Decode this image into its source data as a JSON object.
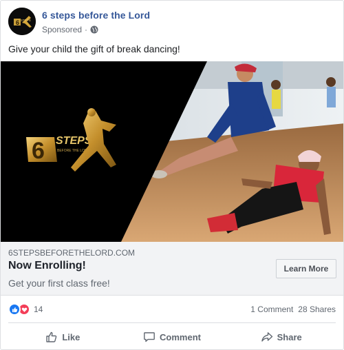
{
  "post": {
    "page_name": "6 steps before the Lord",
    "sponsored_label": "Sponsored",
    "separator": "·",
    "text": "Give your child the gift of break dancing!"
  },
  "media": {
    "logo_word": "STEPS",
    "logo_number": "6",
    "logo_sub": "BEFORE THE LORD"
  },
  "link_preview": {
    "domain": "6STEPSBEFORETHELORD.COM",
    "headline": "Now Enrolling!",
    "description": "Get your first class free!",
    "cta_label": "Learn More"
  },
  "reactions": {
    "count": "14",
    "comments": "1 Comment",
    "shares": "28 Shares",
    "icons": [
      "like-icon",
      "love-icon"
    ]
  },
  "actions": {
    "like": "Like",
    "comment": "Comment",
    "share": "Share"
  },
  "colors": {
    "page_name": "#365899",
    "like_blue": "#1877f2",
    "love_red": "#f33e58",
    "logo_gold": "#d4a63a"
  }
}
